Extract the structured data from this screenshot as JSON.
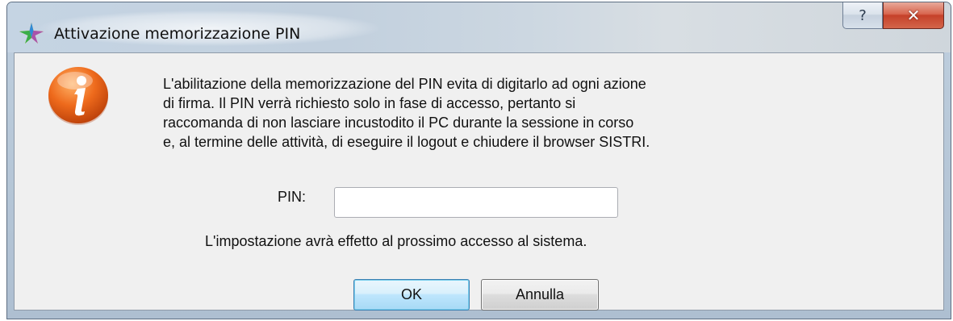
{
  "window": {
    "title": "Attivazione memorizzazione PIN",
    "help_glyph": "?",
    "close_glyph": "✕"
  },
  "dialog": {
    "icon": "info-icon",
    "message_lines": [
      "L'abilitazione della memorizzazione del PIN evita di digitarlo ad ogni azione",
      "di firma. Il PIN verrà richiesto solo in fase di accesso, pertanto si",
      "raccomanda di non lasciare incustodito il PC durante la sessione in corso",
      "e, al termine delle attività, di eseguire il logout e chiudere il browser SISTRI."
    ],
    "pin_label": "PIN:",
    "pin_value": "",
    "hint": "L'impostazione avrà effetto al prossimo accesso al sistema.",
    "ok_label": "OK",
    "cancel_label": "Annulla"
  },
  "colors": {
    "info_icon": "#e8651a",
    "close_button": "#c5412a",
    "ok_border": "#3c7fb1"
  }
}
